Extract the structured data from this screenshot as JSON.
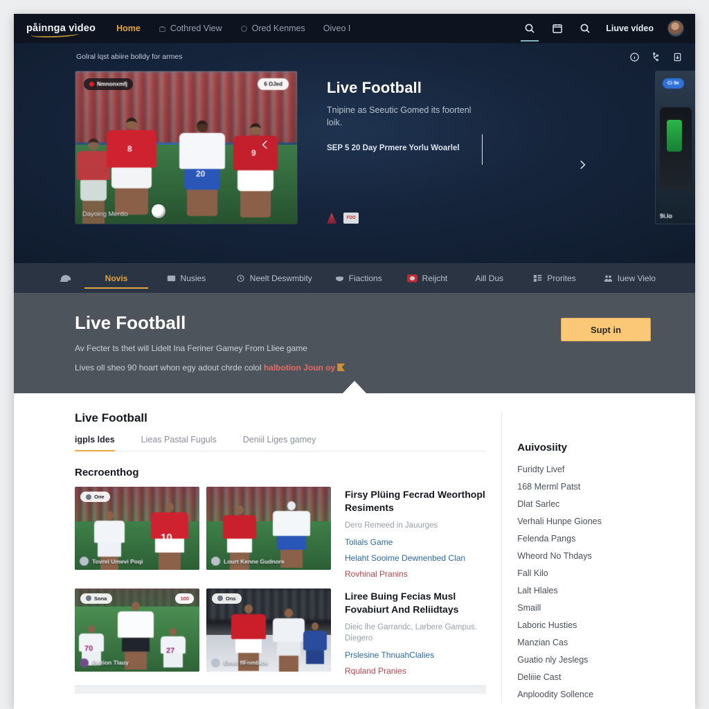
{
  "colors": {
    "topnav_bg": "#0d1420",
    "hero_bg": "#16253c",
    "catbar_bg": "#2b3443",
    "promo_bg": "#4d545c",
    "accent_gold": "#e4a23e",
    "button_bg": "#fbc878",
    "link_blue": "#2d6aa8",
    "link_red": "#b5434a",
    "live_red": "#e0202e"
  },
  "topnav": {
    "brand": "påinnga vìdeo",
    "links": [
      {
        "label": "Home",
        "icon": "none",
        "active": true
      },
      {
        "label": "Cothred View",
        "icon": "bag-icon",
        "active": false
      },
      {
        "label": "Ored Kenmes",
        "icon": "circle-icon",
        "active": false
      },
      {
        "label": "Oiveo I",
        "icon": "none",
        "active": false
      }
    ],
    "right": {
      "search_icon": "search-icon",
      "calendar_icon": "calendar-icon",
      "search_icon_2": "search-icon",
      "live_video_label": "Liuve vídeo",
      "avatar": "avatar"
    }
  },
  "hero": {
    "strip_text": "Golral lqst abiire bolldy for armes",
    "strip_icons": [
      "info-icon",
      "share-icon",
      "download-icon"
    ],
    "card": {
      "live_badge": "Nmnonxmfj",
      "score_badge": "6 OJed",
      "caption": "Dayoing Mentlo",
      "jersey_numbers": [
        "8",
        "9",
        "20"
      ]
    },
    "title": "Live Football",
    "subtitle": "Tnipine as Seeutic Gomed its foortenl loik.",
    "meta": "SEP 5 20 Day Prmere Yorlu Woarlel",
    "chips": [
      "flag-chip-icon",
      "ticket-chip-icon"
    ],
    "peek": {
      "chip": "Ci 9e",
      "caption": "9i.lo"
    },
    "prev_arrow": "chevron-left-icon",
    "next_arrow": "chevron-right-icon"
  },
  "categories": [
    {
      "label": "",
      "icon": "helmet-icon",
      "active": false
    },
    {
      "label": "Novis",
      "icon": "none",
      "active": true
    },
    {
      "label": "Nusies",
      "icon": "tv-icon",
      "active": false
    },
    {
      "label": "Neelt Deswmbity",
      "icon": "clock-icon",
      "active": false
    },
    {
      "label": "Fiactions",
      "icon": "bowl-icon",
      "active": false
    },
    {
      "label": "Reijcht",
      "icon": "record-icon",
      "active": false
    },
    {
      "label": "Aill Dus",
      "icon": "none",
      "active": false
    },
    {
      "label": "Prorites",
      "icon": "grid-icon",
      "active": false
    },
    {
      "label": "Iuew Vielo",
      "icon": "crowd-icon",
      "active": false
    }
  ],
  "promo": {
    "title": "Live Football",
    "line1": "Av Fecter ts thet will Lidelt Ina Feriner Gamey From Lliee game",
    "line2_prefix": "Lives oll sheo 90 hoart whon egy adout chrde colol ",
    "line2_link": "halbotion Joun oy",
    "button": "Supt in"
  },
  "main": {
    "section_title": "Live Football",
    "tabs": [
      {
        "label": "igpls ldes",
        "active": true
      },
      {
        "label": "Lieas Pastal Fuguls",
        "active": false
      },
      {
        "label": "Deniil Liges gamey",
        "active": false
      }
    ],
    "sub_head": "Recroenthog",
    "rows": [
      {
        "thumbs": [
          {
            "badge": "One",
            "badge_right": "",
            "caption": "Tovrel Umevi Poqi"
          },
          {
            "badge": "",
            "badge_right": "",
            "caption": "Lourt Kenne Gudnore"
          }
        ],
        "title": "Firsy Plüing Fecrad Weorthopl Resiments",
        "subtitle": "Dero Remeed in Jauurges",
        "link": "Tolials Game",
        "link2": "Helaht Sooime Dewnenbed Clan",
        "alt": "Rovhinal Pranins"
      },
      {
        "thumbs": [
          {
            "badge": "Sona",
            "badge_right": "100",
            "caption": "Peltion Tlauy"
          },
          {
            "badge": "Ons",
            "badge_right": "",
            "caption": "Emut flFnmbice"
          }
        ],
        "title": "Liree Buing Fecias Musl Fovabiurt And Reliidtays",
        "subtitle": "Dieic lhe Garrandc, Larbere Gampus. Diegero",
        "link": "Prslesine ThnuahClalies",
        "link2": "",
        "alt": "Rquland Pranies"
      }
    ]
  },
  "aside": {
    "title": "Auivosiity",
    "items": [
      "Furidty Livef",
      "168 Merml Patst",
      "Dlat Sarlec",
      "Verhali Hunpe Giones",
      "Felenda Pangs",
      "Wheord No Thdays",
      "Fall Kilo",
      "Lalt Hlales",
      "Smaill",
      "Laboric Husties",
      "Manzian Cas",
      "Guatio nly Jeslegs",
      "Deliiie Cast",
      "Anploodity Sollence"
    ]
  }
}
